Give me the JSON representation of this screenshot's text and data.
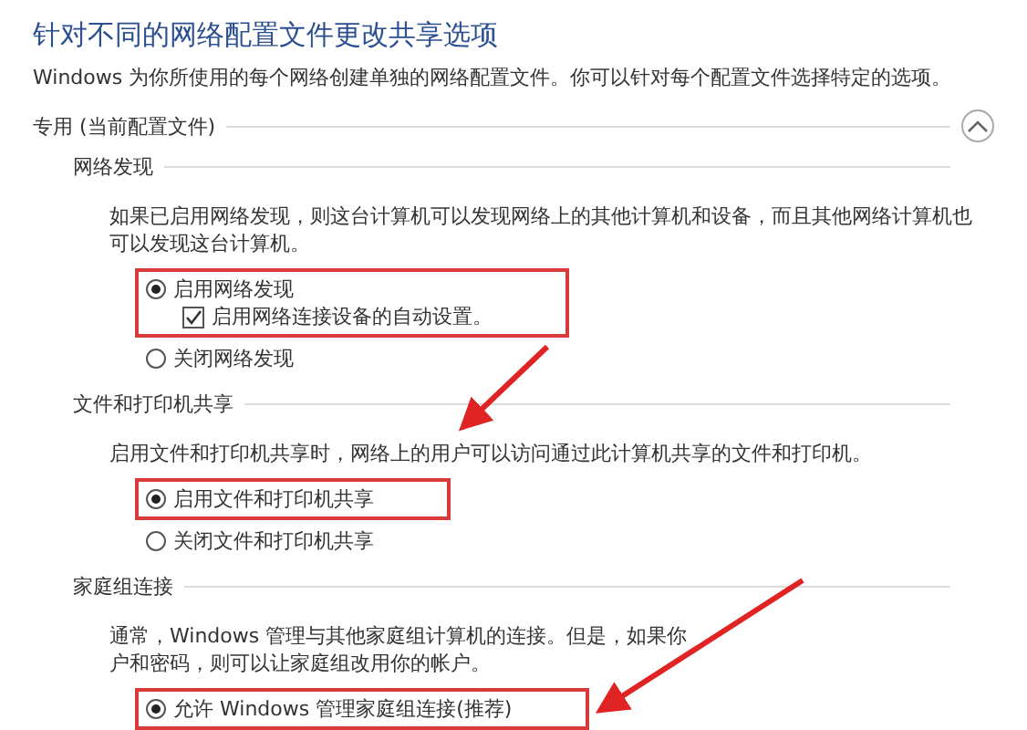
{
  "heading": "针对不同的网络配置文件更改共享选项",
  "description": "Windows 为你所使用的每个网络创建单独的网络配置文件。你可以针对每个配置文件选择特定的选项。",
  "profile": {
    "label": "专用 (当前配置文件)",
    "expanded": true
  },
  "sections": [
    {
      "title": "网络发现",
      "lines": [
        "如果已启用网络发现，则这台计算机可以发现网络上的其他计算机和设备，而且其他网络计算机也",
        "可以发现这台计算机。"
      ],
      "options": [
        {
          "label": "启用网络发现",
          "selected": true,
          "highlighted": true,
          "suboption": {
            "label": "启用网络连接设备的自动设置。",
            "checked": true
          }
        },
        {
          "label": "关闭网络发现",
          "selected": false,
          "highlighted": false
        }
      ]
    },
    {
      "title": "文件和打印机共享",
      "lines": [
        "启用文件和打印机共享时，网络上的用户可以访问通过此计算机共享的文件和打印机。"
      ],
      "options": [
        {
          "label": "启用文件和打印机共享",
          "selected": true,
          "highlighted": true
        },
        {
          "label": "关闭文件和打印机共享",
          "selected": false,
          "highlighted": false
        }
      ]
    },
    {
      "title": "家庭组连接",
      "lines": [
        "通常，Windows 管理与其他家庭组计算机的连接。但是，如果你",
        "户和密码，则可以让家庭组改用你的帐户。"
      ],
      "options": [
        {
          "label": "允许 Windows 管理家庭组连接(推荐)",
          "selected": true,
          "highlighted": true
        }
      ]
    }
  ]
}
